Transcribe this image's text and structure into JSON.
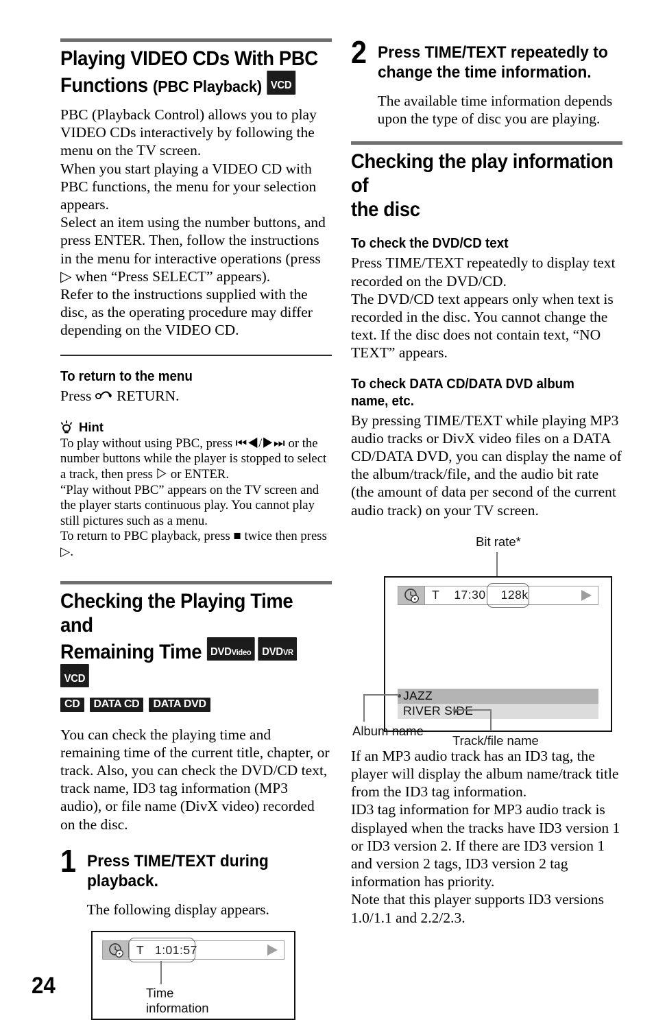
{
  "page": {
    "number": "24"
  },
  "left_column": {
    "section1": {
      "heading_line1": "Playing VIDEO CDs With PBC",
      "heading_line2_big": "Functions",
      "heading_line2_small": "(PBC Playback)",
      "badges": [
        {
          "main": "VCD",
          "sub": ""
        }
      ],
      "paragraphs": [
        "PBC (Playback Control) allows you to play VIDEO CDs interactively by following the menu on the TV screen.",
        "When you start playing a VIDEO CD with PBC functions, the menu for your selection appears.",
        "Select an item using the number buttons, and press ENTER. Then, follow the instructions in the menu for interactive operations (press ▷ when “Press SELECT” appears).",
        "Refer to the instructions supplied with the disc, as the operating procedure may differ depending on the VIDEO CD."
      ]
    },
    "return_menu": {
      "heading": "To return to the menu",
      "text_before": "Press ",
      "icon": "return-arrow-icon",
      "text_after": " RETURN."
    },
    "hint": {
      "icon": "lightbulb-icon",
      "label": "Hint",
      "lines": [
        "To play without using PBC, press ⏮◀/▶⏭ or the number buttons while the player is stopped to select a track, then press ▷ or ENTER.",
        "“Play without PBC” appears on the TV screen and the player starts continuous play. You cannot play still pictures such as a menu.",
        "To return to PBC playback, press ■ twice then press ▷."
      ]
    },
    "section2": {
      "heading_line1": "Checking the Playing Time and",
      "heading_line2": "Remaining Time",
      "badges_inline": [
        {
          "main": "DVD",
          "sub": "Video"
        },
        {
          "main": "DVD",
          "sub": "VR"
        },
        {
          "main": "VCD",
          "sub": ""
        }
      ],
      "badges_row": [
        {
          "main": "CD",
          "sub": ""
        },
        {
          "main": "DATA CD",
          "sub": ""
        },
        {
          "main": "DATA DVD",
          "sub": ""
        }
      ],
      "paragraph": "You can check the playing time and remaining time of the current title, chapter, or track. Also, you can check the DVD/CD text, track name, ID3 tag information (MP3 audio), or file name (DivX video) recorded on the disc."
    },
    "step1": {
      "number": "1",
      "title": "Press TIME/TEXT during playback.",
      "text": "The following display appears."
    },
    "figure1": {
      "osd_icon": "clock-disc-icon",
      "osd_text": "T   1:01:57",
      "play_icon": "play-triangle-icon",
      "callout_label_line1": "Time",
      "callout_label_line2": "information"
    }
  },
  "right_column": {
    "step2": {
      "number": "2",
      "title_line1": "Press TIME/TEXT repeatedly to",
      "title_line2": "change the time information.",
      "text": "The available time information depends upon the type of disc you are playing."
    },
    "section3": {
      "heading_line1": "Checking the play information of",
      "heading_line2": "the disc",
      "sub1": {
        "heading": "To check the DVD/CD text",
        "paragraphs": [
          "Press TIME/TEXT repeatedly to display text recorded on the DVD/CD.",
          "The DVD/CD text appears only when text is recorded in the disc. You cannot change the text. If the disc does not contain text, “NO TEXT” appears."
        ]
      },
      "sub2": {
        "heading_line1": "To check DATA CD/DATA DVD album",
        "heading_line2": "name, etc.",
        "paragraph": "By pressing TIME/TEXT while playing MP3 audio tracks or DivX video files on a DATA CD/DATA DVD, you can display the name of the album/track/file, and the audio bit rate (the amount of data per second of the current audio track) on your TV screen."
      }
    },
    "figure2": {
      "top_label": "Bit rate*",
      "osd_icon": "clock-disc-icon",
      "osd_text": "T    17:30",
      "bitrate_value": "128k",
      "play_icon": "play-triangle-icon",
      "album_name": "JAZZ",
      "track_name": "RIVER SIDE",
      "album_label": "Album name",
      "track_label": "Track/file name"
    },
    "closing": {
      "paragraphs": [
        "If an MP3 audio track has an ID3 tag, the player will display the album name/track title from the ID3 tag information.",
        "ID3 tag information for MP3 audio track is displayed when the tracks have ID3 version 1 or ID3 version 2. If there are ID3 version 1 and version 2 tags, ID3 version 2 tag information has priority.",
        "Note that this player supports ID3 versions 1.0/1.1 and 2.2/2.3."
      ]
    }
  }
}
